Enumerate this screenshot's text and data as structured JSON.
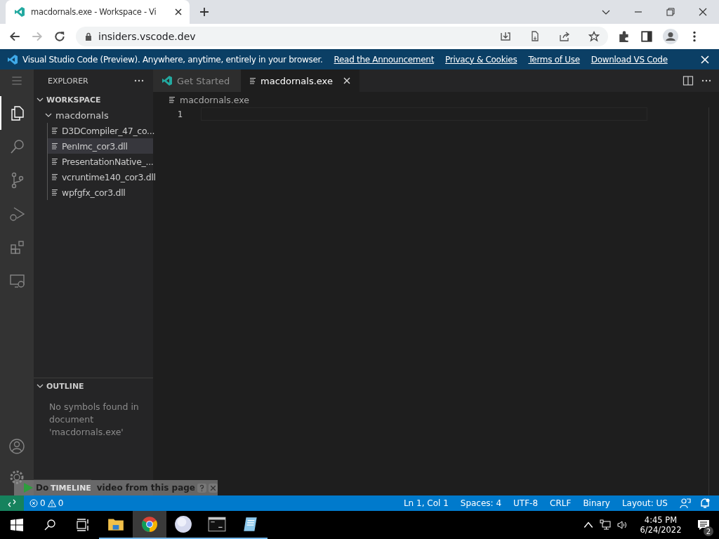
{
  "browser": {
    "tab_title": "macdornals.exe - Workspace - Vi",
    "url": "insiders.vscode.dev"
  },
  "banner": {
    "text": "Visual Studio Code (Preview). Anywhere, anytime, entirely in your browser.",
    "links": [
      "Read the Announcement",
      "Privacy & Cookies",
      "Terms of Use",
      "Download VS Code"
    ]
  },
  "activity_bar": [
    {
      "kind": "explorer",
      "selected": true
    },
    {
      "kind": "search",
      "selected": false
    },
    {
      "kind": "scm",
      "selected": false
    },
    {
      "kind": "debug",
      "selected": false
    },
    {
      "kind": "extensions",
      "selected": false
    },
    {
      "kind": "remote",
      "selected": false
    }
  ],
  "sidebar": {
    "title": "EXPLORER",
    "workspace": {
      "title": "WORKSPACE",
      "expanded": true,
      "tree": [
        {
          "label": "macdornals",
          "expanded": true,
          "children": [
            {
              "label": "D3DCompiler_47_co...",
              "selected": false
            },
            {
              "label": "PenImc_cor3.dll",
              "selected": true
            },
            {
              "label": "PresentationNative_...",
              "selected": false
            },
            {
              "label": "vcruntime140_cor3.dll",
              "selected": false
            },
            {
              "label": "wpfgfx_cor3.dll",
              "selected": false
            }
          ]
        }
      ]
    },
    "outline": {
      "title": "OUTLINE",
      "expanded": true,
      "message": "No symbols found in document 'macdornals.exe'"
    },
    "timeline": {
      "title": "TIMELINE"
    }
  },
  "editor": {
    "tabs": [
      {
        "label": "Get Started",
        "kind": "welcome",
        "selected": false
      },
      {
        "label": "macdornals.exe",
        "kind": "file",
        "selected": true
      }
    ],
    "breadcrumb": "macdornals.exe",
    "line_numbers": [
      "1"
    ]
  },
  "overlay": {
    "text_start": "Do",
    "text_end": "video from this page"
  },
  "status_bar": {
    "errors": "0",
    "warnings": "0",
    "items": [
      "Ln 1, Col 1",
      "Spaces: 4",
      "UTF-8",
      "CRLF",
      "Binary",
      "Layout: US"
    ]
  },
  "taskbar": {
    "apps": [
      {
        "kind": "folder",
        "selected": false
      },
      {
        "kind": "chrome",
        "selected": true
      },
      {
        "kind": "orb",
        "selected": false
      },
      {
        "kind": "terminal",
        "selected": false
      },
      {
        "kind": "notepad",
        "selected": false
      }
    ],
    "time": "4:45 PM",
    "date": "6/24/2022",
    "notifications": "2"
  }
}
